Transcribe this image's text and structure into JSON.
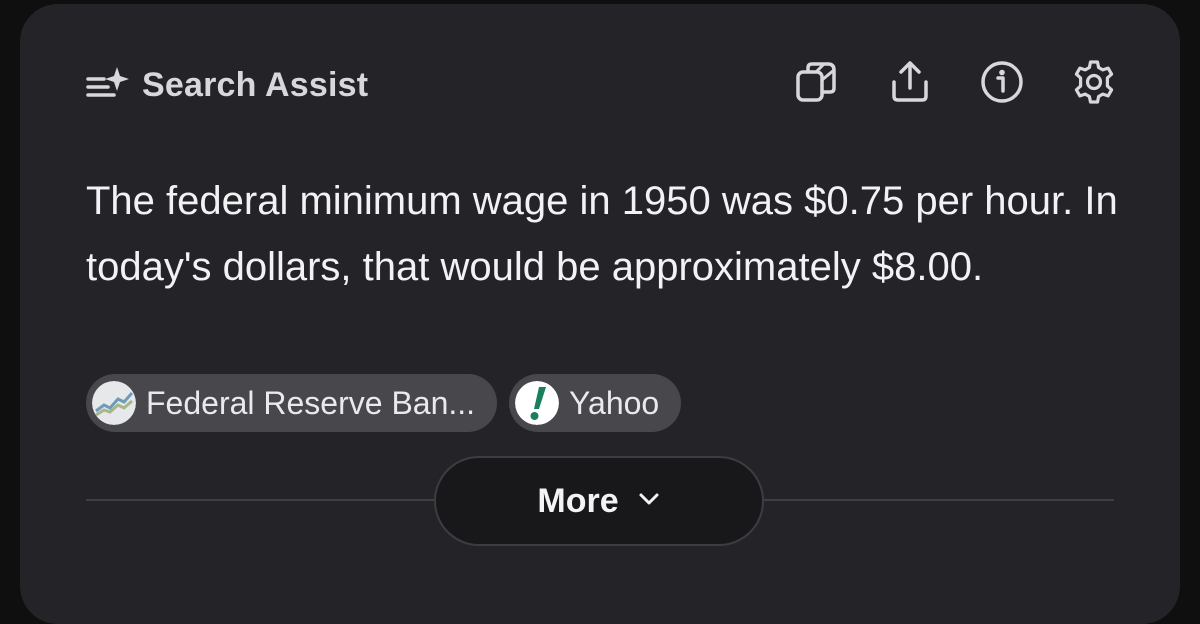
{
  "header": {
    "icon": "sparkle-list-icon",
    "title": "Search Assist"
  },
  "actions": [
    {
      "name": "copy-icon",
      "tooltip": ""
    },
    {
      "name": "share-icon",
      "tooltip": ""
    },
    {
      "name": "info-icon",
      "tooltip": ""
    },
    {
      "name": "gear-icon",
      "tooltip": ""
    }
  ],
  "answer": {
    "text": "The federal minimum wage in 1950 was $0.75 per hour. In today's dollars, that would be approximately $8.00."
  },
  "sources": [
    {
      "label": "Federal Reserve Ban...",
      "icon": "federal-reserve-favicon"
    },
    {
      "label": "Yahoo",
      "icon": "yahoo-favicon"
    }
  ],
  "more": {
    "label": "More",
    "icon": "chevron-down-icon"
  },
  "colors": {
    "card_background": "#242428",
    "chip_background": "#47474c",
    "yahoo_green": "#1a7f5a"
  }
}
